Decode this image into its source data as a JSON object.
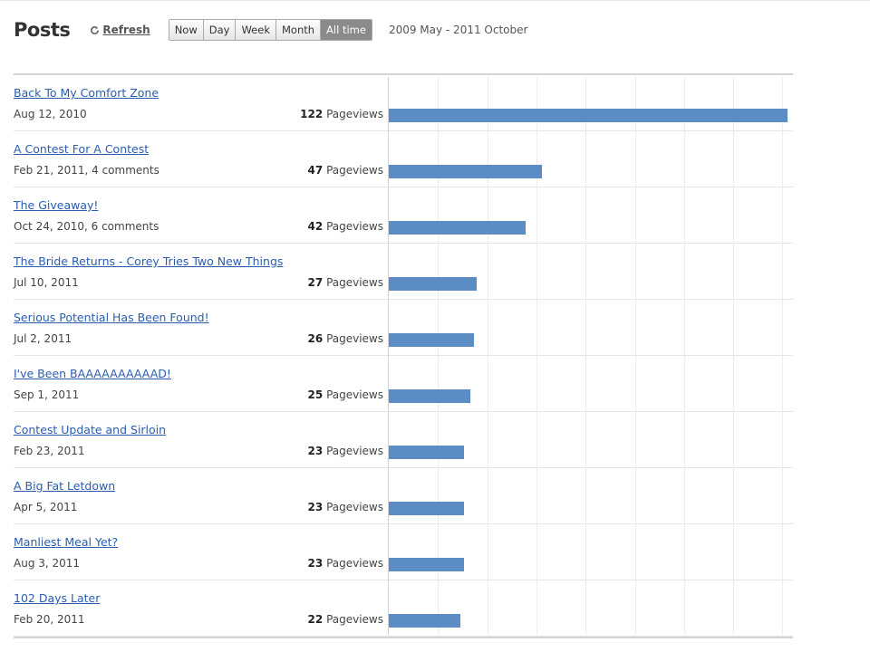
{
  "header": {
    "title": "Posts",
    "refresh_label": "Refresh",
    "ranges": [
      {
        "label": "Now",
        "active": false
      },
      {
        "label": "Day",
        "active": false
      },
      {
        "label": "Week",
        "active": false
      },
      {
        "label": "Month",
        "active": false
      },
      {
        "label": "All time",
        "active": true
      }
    ],
    "date_range": "2009 May - 2011 October"
  },
  "colors": {
    "bar": "#5b8cc4",
    "link": "#2a5db0"
  },
  "pageviews_label": "Pageviews",
  "chart_data": {
    "type": "bar",
    "categories": [
      "Back To My Comfort Zone",
      "A Contest For A Contest",
      "The Giveaway!",
      "The Bride Returns - Corey Tries Two New Things",
      "Serious Potential Has Been Found!",
      "I've Been BAAAAAAAAAAD!",
      "Contest Update and Sirloin",
      "A Big Fat Letdown",
      "Manliest Meal Yet?",
      "102 Days Later"
    ],
    "values": [
      122,
      47,
      42,
      27,
      26,
      25,
      23,
      23,
      23,
      22
    ],
    "xlim": [
      0,
      124
    ]
  },
  "posts": [
    {
      "title": "Back To My Comfort Zone",
      "meta": "Aug 12, 2010",
      "views": "122"
    },
    {
      "title": "A Contest For A Contest",
      "meta": "Feb 21, 2011, 4 comments",
      "views": "47"
    },
    {
      "title": "The Giveaway!",
      "meta": "Oct 24, 2010, 6 comments",
      "views": "42"
    },
    {
      "title": "The Bride Returns - Corey Tries Two New Things",
      "meta": "Jul 10, 2011",
      "views": "27"
    },
    {
      "title": "Serious Potential Has Been Found!",
      "meta": "Jul 2, 2011",
      "views": "26"
    },
    {
      "title": "I've Been BAAAAAAAAAAD!",
      "meta": "Sep 1, 2011",
      "views": "25"
    },
    {
      "title": "Contest Update and Sirloin",
      "meta": "Feb 23, 2011",
      "views": "23"
    },
    {
      "title": "A Big Fat Letdown",
      "meta": "Apr 5, 2011",
      "views": "23"
    },
    {
      "title": "Manliest Meal Yet?",
      "meta": "Aug 3, 2011",
      "views": "23"
    },
    {
      "title": "102 Days Later",
      "meta": "Feb 20, 2011",
      "views": "22"
    }
  ]
}
